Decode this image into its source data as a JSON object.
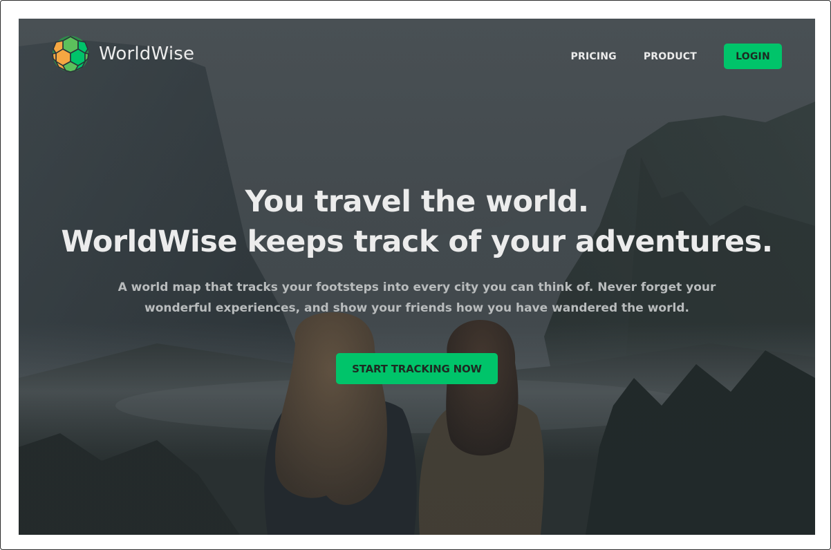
{
  "brand": {
    "name": "WorldWise",
    "logo_icon": "worldwise-globe-logo",
    "logo_colors": [
      "#f5a742",
      "#00c46a",
      "#5cc05c"
    ]
  },
  "nav": {
    "links": [
      {
        "label": "PRICING"
      },
      {
        "label": "PRODUCT"
      }
    ],
    "login_label": "LOGIN"
  },
  "hero": {
    "headline_line1": "You travel the world.",
    "headline_line2": "WorldWise keeps track of your adventures.",
    "subheadline": "A world map that tracks your footsteps into every city you can think of. Never forget your wonderful experiences, and show your friends how you have wandered the world.",
    "cta_label": "START TRACKING NOW",
    "background_image": "two-travelers-viewing-mountain-valley"
  },
  "colors": {
    "accent": "#00c46a",
    "text_light": "#ececec",
    "text_muted": "#b9bcbd",
    "overlay": "#2d3439"
  }
}
